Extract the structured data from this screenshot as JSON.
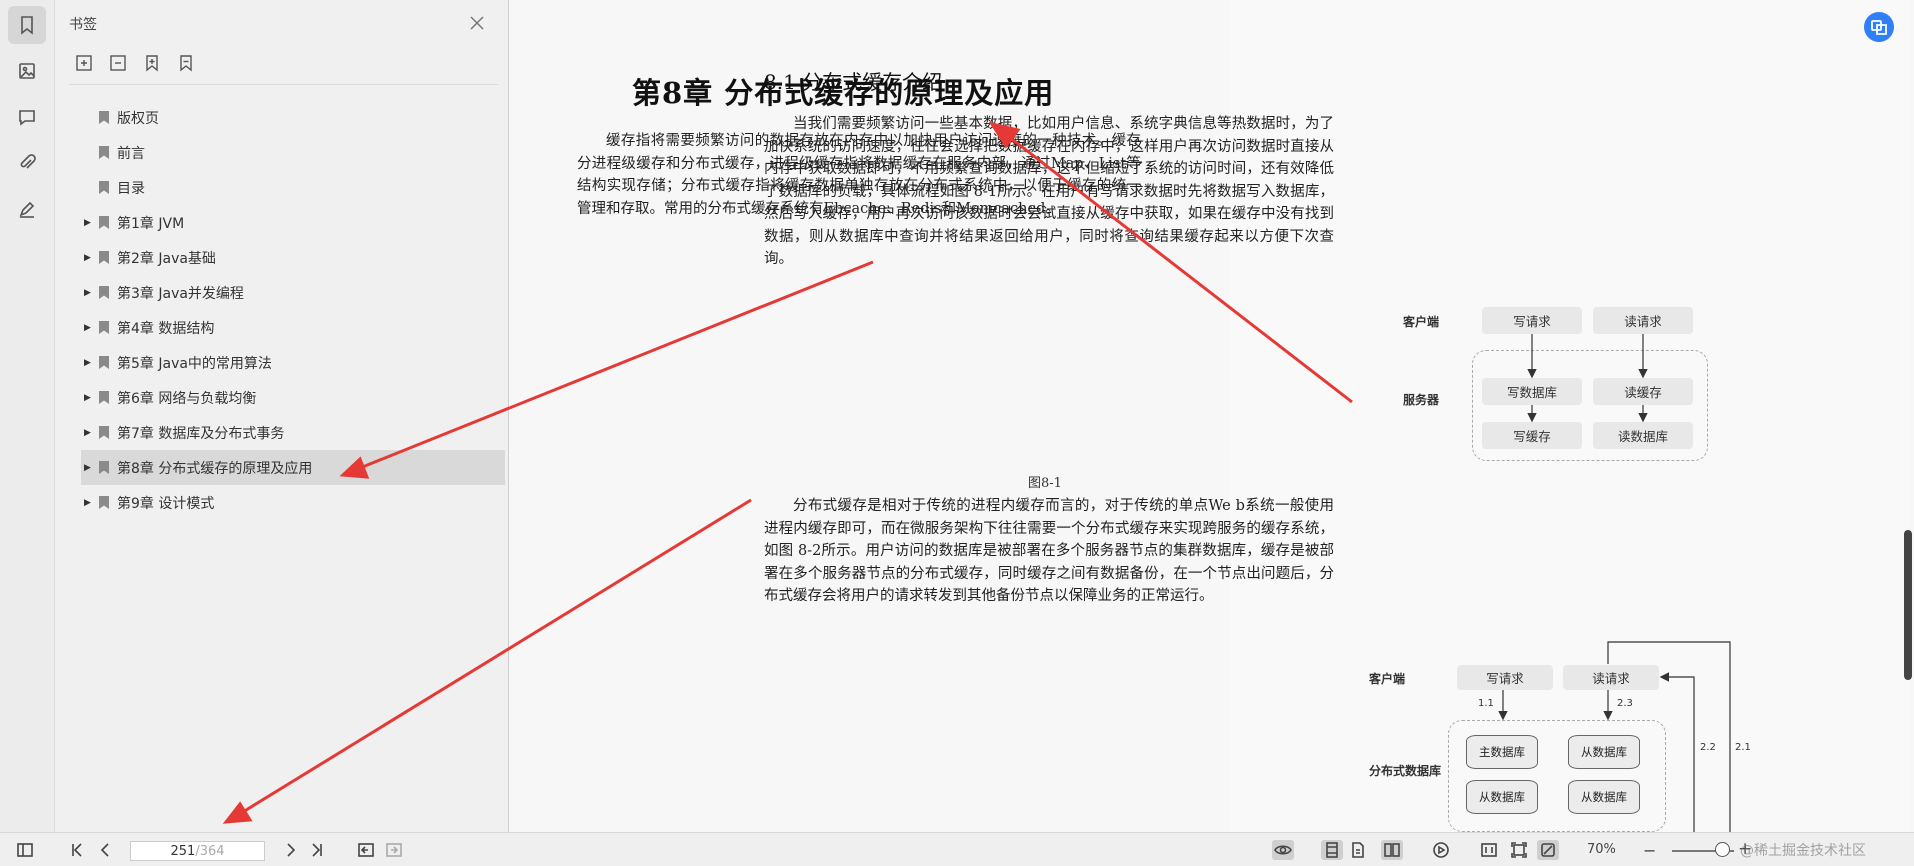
{
  "rail": {
    "icons": [
      "bookmark-icon",
      "image-icon",
      "comment-icon",
      "attachment-icon",
      "signature-icon"
    ]
  },
  "bookmark_panel": {
    "title": "书签",
    "items": [
      {
        "label": "版权页",
        "expandable": false,
        "selected": false
      },
      {
        "label": "前言",
        "expandable": false,
        "selected": false
      },
      {
        "label": "目录",
        "expandable": false,
        "selected": false
      },
      {
        "label": "第1章 JVM",
        "expandable": true,
        "selected": false
      },
      {
        "label": "第2章 Java基础",
        "expandable": true,
        "selected": false
      },
      {
        "label": "第3章 Java并发编程",
        "expandable": true,
        "selected": false
      },
      {
        "label": "第4章 数据结构",
        "expandable": true,
        "selected": false
      },
      {
        "label": "第5章 Java中的常用算法",
        "expandable": true,
        "selected": false
      },
      {
        "label": "第6章 网络与负载均衡",
        "expandable": true,
        "selected": false
      },
      {
        "label": "第7章 数据库及分布式事务",
        "expandable": true,
        "selected": false
      },
      {
        "label": "第8章 分布式缓存的原理及应用",
        "expandable": true,
        "selected": true
      },
      {
        "label": "第9章 设计模式",
        "expandable": true,
        "selected": false
      }
    ]
  },
  "document": {
    "chapter_title": "第8章  分布式缓存的原理及应用",
    "intro_paragraph": "缓存指将需要频繁访问的数据存放在内存中以加快用户访问速度的一种技术。缓存分进程级缓存和分布式缓存，进程级缓存指将数据缓存在服务内部，通过Map、List等结构实现存储；分布式缓存指将缓存数据单独存放在分布式系统中，以便于缓存的统一管理和存取。常用的分布式缓存系统有Ehcache、Redis和Memcached。",
    "section_title": "8.1  分布式缓存介绍",
    "section_paragraph_1": "当我们需要频繁访问一些基本数据，比如用户信息、系统字典信息等热数据时，为了加快系统的访问速度，往往会选择把数据缓存在内存中，这样用户再次访问数据时直接从内存中获取数据即可，不用频繁查询数据库，这不但缩短了系统的访问时间，还有效降低了数据库的负载，具体流程如图 8-1所示。在用户有写请求数据时先将数据写入数据库，然后写入缓存，用户再次访问该数据时会尝试直接从缓存中获取，如果在缓存中没有找到数据，则从数据库中查询并将结果返回给用户，同时将查询结果缓存起来以方便下次查询。",
    "figure_caption": "图8-1",
    "section_paragraph_2": "分布式缓存是相对于传统的进程内缓存而言的，对于传统的单点We b系统一般使用进程内缓存即可，而在微服务架构下往往需要一个分布式缓存来实现跨服务的缓存系统，如图 8-2所示。用户访问的数据库是被部署在多个服务器节点的集群数据库，缓存是被部署在多个服务器节点的分布式缓存，同时缓存之间有数据备份，在一个节点出问题后，分布式缓存会将用户的请求转发到其他备份节点以保障业务的正常运行。",
    "fig1": {
      "client_label": "客户端",
      "server_label": "服务器",
      "write_request": "写请求",
      "read_request": "读请求",
      "write_db": "写数据库",
      "read_cache": "读缓存",
      "write_cache": "写缓存",
      "read_db": "读数据库"
    },
    "fig2": {
      "client_label": "客户端",
      "db_label": "分布式数据库",
      "write_request": "写请求",
      "read_request": "读请求",
      "main_db": "主数据库",
      "slave_db_1": "从数据库",
      "slave_db_2": "从数据库",
      "slave_db_3": "从数据库",
      "n11": "1.1",
      "n23": "2.3",
      "n22": "2.2",
      "n21": "2.1"
    }
  },
  "bottom_bar": {
    "current_page": "251",
    "total_pages": "/364",
    "zoom": "70%",
    "zoom_level_fraction": 0.8,
    "watermark": "@稀土掘金技术社区"
  },
  "accent_color": "#2f7ff6",
  "annotation_color": "#e53935"
}
